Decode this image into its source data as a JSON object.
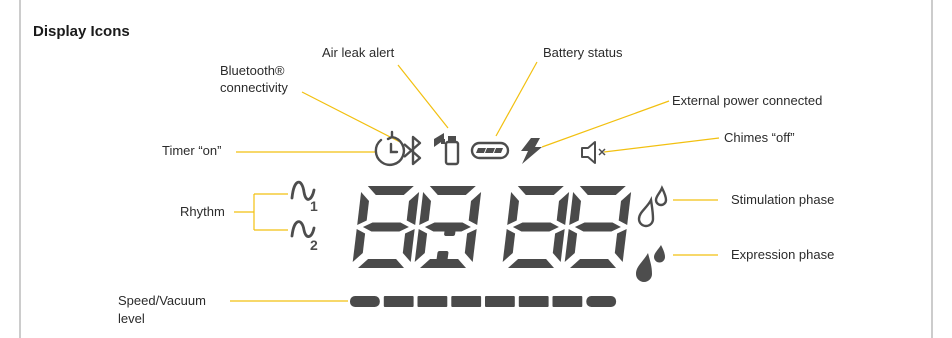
{
  "title": "Display Icons",
  "labels": {
    "bluetooth_line1": "Bluetooth®",
    "bluetooth_line2": "connectivity",
    "air_leak": "Air leak alert",
    "battery": "Battery status",
    "external_power": "External power connected",
    "timer": "Timer “on”",
    "chimes": "Chimes “off”",
    "rhythm": "Rhythm",
    "stimulation": "Stimulation phase",
    "expression": "Expression phase",
    "speed_line1": "Speed/Vacuum",
    "speed_line2": "level"
  },
  "icons": {
    "timer": "clock-icon",
    "bluetooth": "bluetooth-icon",
    "air_leak": "air-leak-icon",
    "battery": "battery-icon",
    "power": "lightning-icon",
    "chimes": "speaker-mute-icon",
    "rhythm1": "rhythm-wave-1-icon",
    "rhythm2": "rhythm-wave-2-icon",
    "stimulation": "droplet-outline-icon",
    "expression": "droplet-filled-icon"
  },
  "rhythm_numbers": [
    "1",
    "2"
  ],
  "speed_level_segments": 8,
  "colors": {
    "leader_line": "#f2c010",
    "icon": "#4d4d4d",
    "segment": "#4a4a4a",
    "text": "#2b2b2b",
    "frame": "#9a9a9a"
  }
}
